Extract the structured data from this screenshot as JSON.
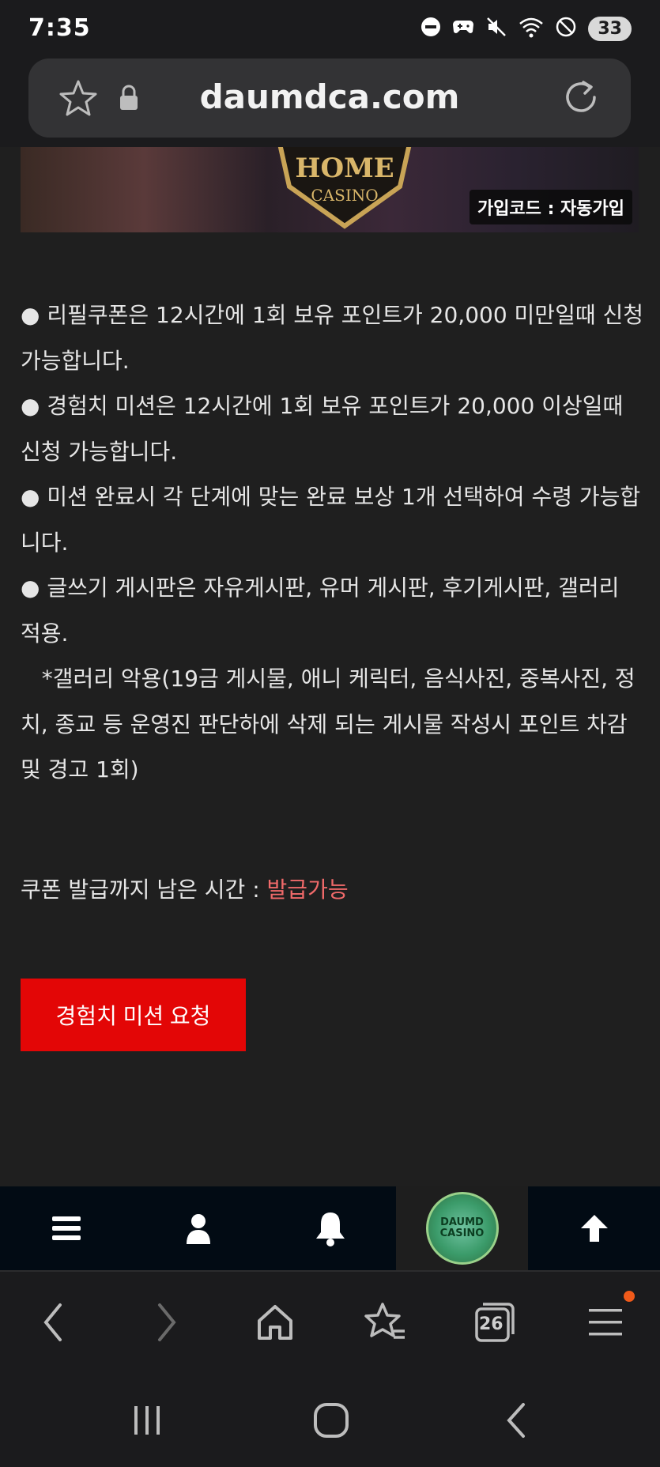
{
  "status_bar": {
    "time": "7:35",
    "battery": "33"
  },
  "browser": {
    "url": "daumdca.com",
    "tab_count": "26"
  },
  "banner": {
    "logo_line1": "HOME",
    "logo_line2": "CASINO",
    "join_code": "가입코드 : 자동가입"
  },
  "rules": [
    "● 리필쿠폰은 12시간에 1회 보유 포인트가 20,000 미만일때 신청 가능합니다.",
    "● 경험치 미션은 12시간에 1회 보유 포인트가 20,000 이상일때 신청 가능합니다.",
    "● 미션 완료시 각 단계에 맞는 완료 보상 1개 선택하여 수령 가능합니다.",
    "● 글쓰기 게시판은 자유게시판, 유머 게시판, 후기게시판, 갤러리 적용.",
    "   *갤러리 악용(19금 게시물, 애니 케릭터, 음식사진, 중복사진, 정치, 종교 등 운영진 판단하에 삭제 되는 게시물 작성시 포인트 차감 및 경고 1회)"
  ],
  "timer": {
    "label": "쿠폰 발급까지 남은 시간 : ",
    "value": "발급가능"
  },
  "mission_button": "경험치 미션 요청",
  "site_nav": {
    "logo_line1": "DAUMD",
    "logo_line2": "CASINO"
  },
  "colors": {
    "accent_red": "#e30606",
    "available_text": "#f06a6a",
    "background": "#1f1f1f"
  }
}
